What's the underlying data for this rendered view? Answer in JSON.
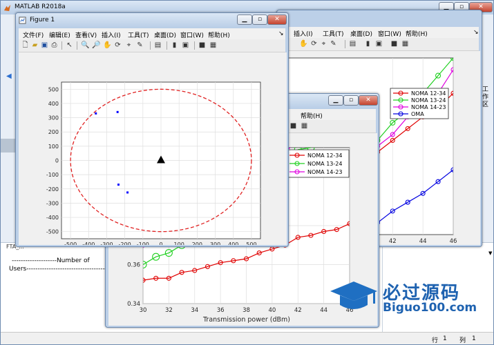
{
  "matlab": {
    "title": "MATLAB R2018a",
    "right_label": "工作区"
  },
  "cmd": {
    "file_tab": "FTA_...",
    "lines": [
      "--------------------Number of",
      "Users--------------------------------------"
    ],
    "status_row": "行",
    "status_row_val": "1",
    "status_col": "列",
    "status_col_val": "1"
  },
  "fig1": {
    "title": "Figure 1",
    "menus": [
      "文件(F)",
      "编辑(E)",
      "查看(V)",
      "插入(I)",
      "工具(T)",
      "桌面(D)",
      "窗口(W)",
      "帮助(H)"
    ],
    "chart_data": {
      "type": "scatter",
      "xlim": [
        -550,
        550
      ],
      "ylim": [
        -550,
        550
      ],
      "xticks": [
        -500,
        -400,
        -300,
        -200,
        -100,
        0,
        100,
        200,
        300,
        400,
        500
      ],
      "yticks": [
        -500,
        -400,
        -300,
        -200,
        -100,
        0,
        100,
        200,
        300,
        400,
        500
      ],
      "grid": true,
      "points": [
        [
          -360,
          330
        ],
        [
          -240,
          340
        ],
        [
          -235,
          -170
        ],
        [
          -185,
          -225
        ]
      ],
      "base_station": [
        0,
        0
      ],
      "circle_radius": 500,
      "point_color": "#0000ff",
      "circle_color": "#e02020",
      "bs_color": "#000000"
    }
  },
  "fig_back": {
    "menus": [
      "插入(I)",
      "工具(T)",
      "桌面(D)",
      "窗口(W)",
      "帮助(H)"
    ],
    "chart_data": {
      "type": "line",
      "x": [
        30,
        31,
        32,
        33,
        34,
        35,
        36,
        37,
        38,
        39,
        40,
        41,
        42,
        43,
        44,
        45,
        46
      ],
      "xlim": [
        30,
        46
      ],
      "xticks": [
        42,
        44,
        46
      ],
      "xlabel_visible": "Bm)",
      "ylim": [
        0.4,
        0.7
      ],
      "series": [
        {
          "name": "NOMA 12-34",
          "color": "#e00000",
          "values": [
            0.4,
            0.41,
            0.42,
            0.43,
            0.44,
            0.45,
            0.46,
            0.47,
            0.48,
            0.5,
            0.52,
            0.54,
            0.56,
            0.58,
            0.6,
            0.615,
            0.64
          ]
        },
        {
          "name": "NOMA 13-24",
          "color": "#20d020",
          "values": [
            0.42,
            0.43,
            0.44,
            0.45,
            0.46,
            0.47,
            0.48,
            0.49,
            0.5,
            0.52,
            0.54,
            0.56,
            0.59,
            0.61,
            0.64,
            0.67,
            0.7
          ]
        },
        {
          "name": "NOMA 14-23",
          "color": "#e000e0",
          "values": [
            0.41,
            0.42,
            0.43,
            0.44,
            0.45,
            0.46,
            0.47,
            0.48,
            0.49,
            0.51,
            0.53,
            0.55,
            0.57,
            0.6,
            0.62,
            0.64,
            0.68
          ]
        },
        {
          "name": "OMA",
          "color": "#0000e0",
          "values": [
            0.3,
            0.31,
            0.32,
            0.33,
            0.34,
            0.35,
            0.36,
            0.37,
            0.38,
            0.39,
            0.4,
            0.42,
            0.44,
            0.455,
            0.47,
            0.49,
            0.51
          ]
        }
      ]
    }
  },
  "fig_mid": {
    "menus": [
      "帮助(H)"
    ],
    "chart_data": {
      "type": "line",
      "x": [
        30,
        31,
        32,
        33,
        34,
        35,
        36,
        37,
        38,
        39,
        40,
        41,
        42,
        43,
        44,
        45,
        46
      ],
      "xlim": [
        30,
        46
      ],
      "ylim": [
        0.34,
        0.42
      ],
      "xticks": [
        30,
        32,
        34,
        36,
        38,
        40,
        42,
        44,
        46
      ],
      "yticks": [
        0.34,
        0.36,
        0.38
      ],
      "xlabel": "Transmission power (dBm)",
      "series": [
        {
          "name": "NOMA 12-34",
          "color": "#e00000",
          "values": [
            0.352,
            0.353,
            0.353,
            0.356,
            0.357,
            0.359,
            0.361,
            0.362,
            0.363,
            0.366,
            0.368,
            0.37,
            0.374,
            0.375,
            0.377,
            0.378,
            0.381
          ]
        },
        {
          "name": "NOMA 13-24",
          "color": "#20d020",
          "values": [
            0.36,
            0.364,
            0.366,
            0.37,
            0.374,
            0.379,
            0.383,
            0.387,
            0.392,
            0.396,
            0.402,
            0.41,
            0.419,
            0.42,
            0.424,
            0.428,
            0.432
          ]
        },
        {
          "name": "NOMA 14-23",
          "color": "#e000e0",
          "values": [
            0.37,
            0.374,
            0.378,
            0.382,
            0.386,
            0.39,
            0.395,
            0.4,
            0.405,
            0.41,
            0.414,
            0.418,
            0.423,
            0.427,
            0.431,
            0.436,
            0.441
          ]
        }
      ]
    }
  },
  "watermark": {
    "cn": "必过源码",
    "url": "Biguo100.com"
  }
}
